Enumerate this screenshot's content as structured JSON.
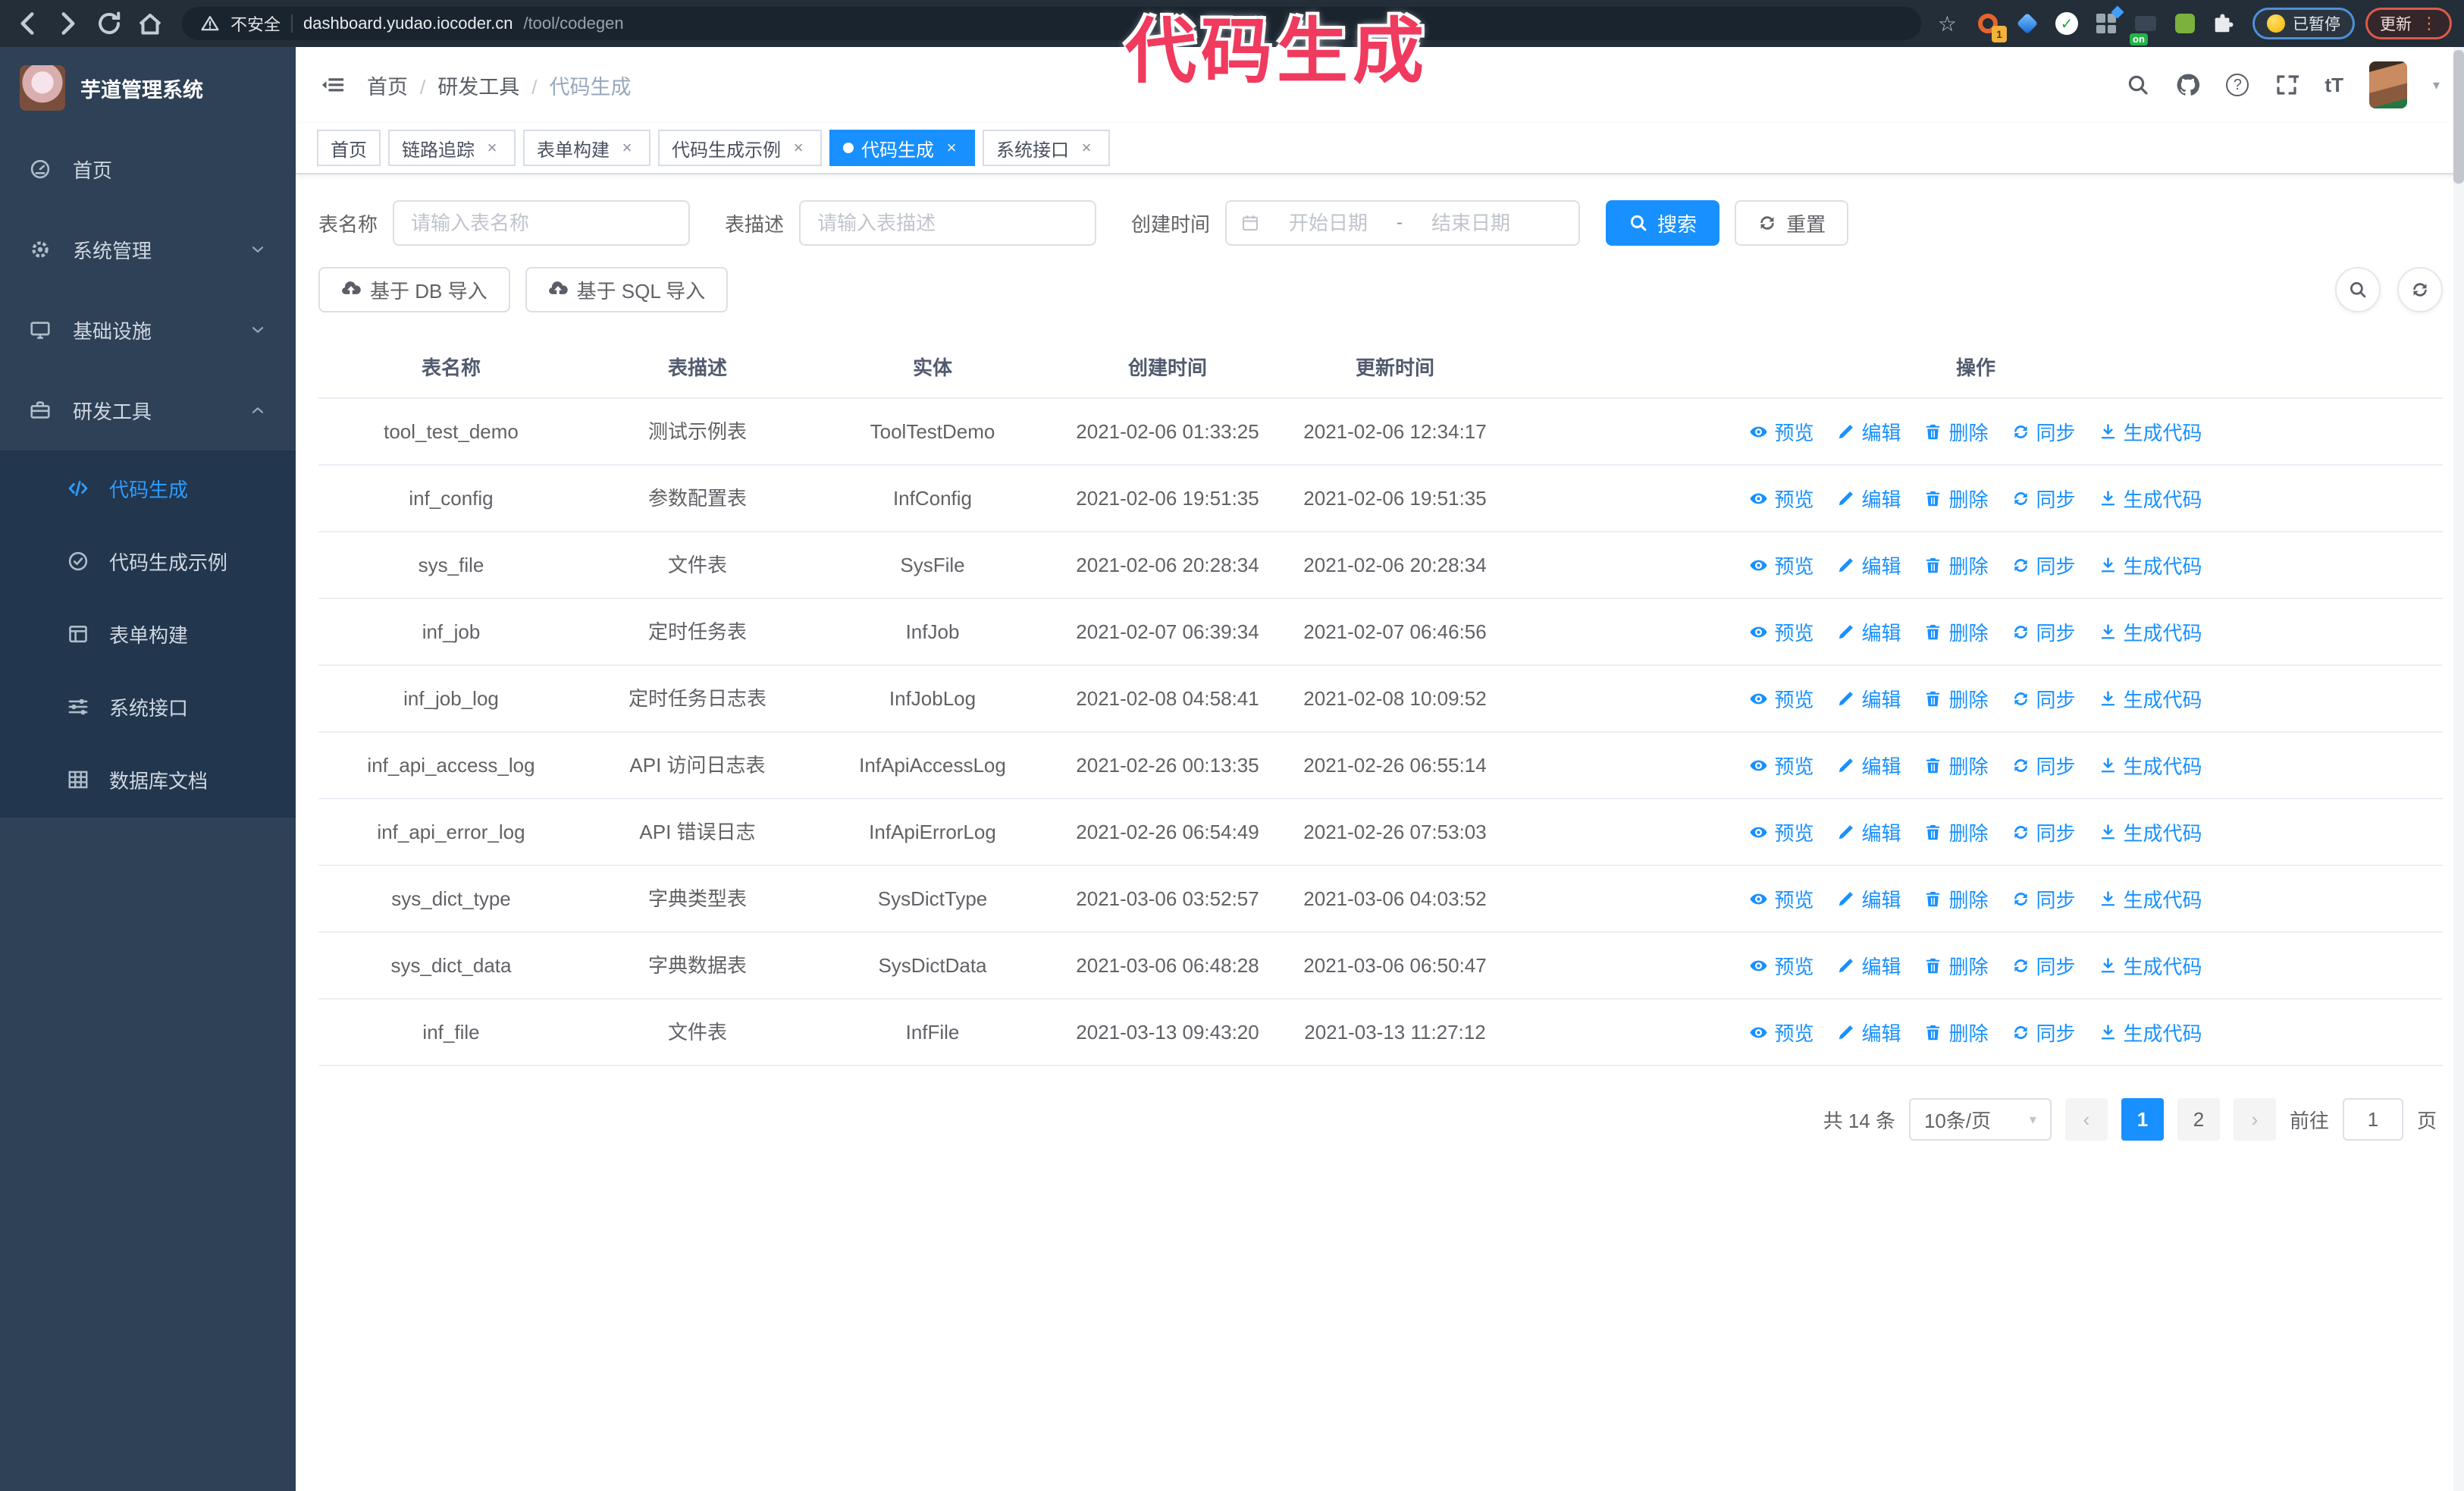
{
  "browser": {
    "security_label": "不安全",
    "url_domain": "dashboard.yudao.iocoder.cn",
    "url_path": "/tool/codegen",
    "extension_badge_1": "1",
    "extension_badge_on": "on",
    "paused_chip": "已暂停",
    "update_button": "更新"
  },
  "overlay": {
    "text": "代码生成"
  },
  "icons": {
    "close": "×",
    "star": "☆",
    "caret_down": "▾",
    "prev": "‹",
    "next": "›",
    "dots_vertical": "⋮",
    "check": "✓",
    "question": "?",
    "font_size": "tT"
  },
  "sidebar": {
    "title": "芋道管理系统",
    "items": [
      {
        "label": "首页",
        "icon": "dashboard-icon",
        "arrow": ""
      },
      {
        "label": "系统管理",
        "icon": "gear-icon",
        "arrow": "down"
      },
      {
        "label": "基础设施",
        "icon": "monitor-icon",
        "arrow": "down"
      },
      {
        "label": "研发工具",
        "icon": "toolbox-icon",
        "arrow": "up"
      }
    ],
    "submenu": [
      {
        "label": "代码生成",
        "icon": "code-icon",
        "active": true
      },
      {
        "label": "代码生成示例",
        "icon": "check-circle-icon",
        "active": false
      },
      {
        "label": "表单构建",
        "icon": "form-icon",
        "active": false
      },
      {
        "label": "系统接口",
        "icon": "sliders-icon",
        "active": false
      },
      {
        "label": "数据库文档",
        "icon": "grid-icon",
        "active": false
      }
    ]
  },
  "topbar": {
    "breadcrumb": [
      "首页",
      "研发工具",
      "代码生成"
    ],
    "separator": "/"
  },
  "tabs": [
    {
      "label": "首页",
      "active": false,
      "closable": false
    },
    {
      "label": "链路追踪",
      "active": false,
      "closable": true
    },
    {
      "label": "表单构建",
      "active": false,
      "closable": true
    },
    {
      "label": "代码生成示例",
      "active": false,
      "closable": true
    },
    {
      "label": "代码生成",
      "active": true,
      "closable": true
    },
    {
      "label": "系统接口",
      "active": false,
      "closable": true
    }
  ],
  "filters": {
    "name_label": "表名称",
    "name_placeholder": "请输入表名称",
    "desc_label": "表描述",
    "desc_placeholder": "请输入表描述",
    "time_label": "创建时间",
    "start_placeholder": "开始日期",
    "range_separator": "-",
    "end_placeholder": "结束日期",
    "search_label": "搜索",
    "reset_label": "重置"
  },
  "toolbar": {
    "import_db": "基于 DB 导入",
    "import_sql": "基于 SQL 导入"
  },
  "table": {
    "columns": [
      "表名称",
      "表描述",
      "实体",
      "创建时间",
      "更新时间",
      "操作"
    ],
    "actions": [
      "预览",
      "编辑",
      "删除",
      "同步",
      "生成代码"
    ],
    "rows": [
      {
        "name": "tool_test_demo",
        "desc": "测试示例表",
        "entity": "ToolTestDemo",
        "created": "2021-02-06 01:33:25",
        "updated": "2021-02-06 12:34:17"
      },
      {
        "name": "inf_config",
        "desc": "参数配置表",
        "entity": "InfConfig",
        "created": "2021-02-06 19:51:35",
        "updated": "2021-02-06 19:51:35"
      },
      {
        "name": "sys_file",
        "desc": "文件表",
        "entity": "SysFile",
        "created": "2021-02-06 20:28:34",
        "updated": "2021-02-06 20:28:34"
      },
      {
        "name": "inf_job",
        "desc": "定时任务表",
        "entity": "InfJob",
        "created": "2021-02-07 06:39:34",
        "updated": "2021-02-07 06:46:56"
      },
      {
        "name": "inf_job_log",
        "desc": "定时任务日志表",
        "entity": "InfJobLog",
        "created": "2021-02-08 04:58:41",
        "updated": "2021-02-08 10:09:52"
      },
      {
        "name": "inf_api_access_log",
        "desc": "API 访问日志表",
        "entity": "InfApiAccessLog",
        "created": "2021-02-26 00:13:35",
        "updated": "2021-02-26 06:55:14"
      },
      {
        "name": "inf_api_error_log",
        "desc": "API 错误日志",
        "entity": "InfApiErrorLog",
        "created": "2021-02-26 06:54:49",
        "updated": "2021-02-26 07:53:03"
      },
      {
        "name": "sys_dict_type",
        "desc": "字典类型表",
        "entity": "SysDictType",
        "created": "2021-03-06 03:52:57",
        "updated": "2021-03-06 04:03:52"
      },
      {
        "name": "sys_dict_data",
        "desc": "字典数据表",
        "entity": "SysDictData",
        "created": "2021-03-06 06:48:28",
        "updated": "2021-03-06 06:50:47"
      },
      {
        "name": "inf_file",
        "desc": "文件表",
        "entity": "InfFile",
        "created": "2021-03-13 09:43:20",
        "updated": "2021-03-13 11:27:12"
      }
    ]
  },
  "pagination": {
    "total_label": "共 14 条",
    "page_size": "10条/页",
    "pages": [
      "1",
      "2"
    ],
    "current": "1",
    "goto_label": "前往",
    "goto_value": "1",
    "page_label": "页"
  }
}
